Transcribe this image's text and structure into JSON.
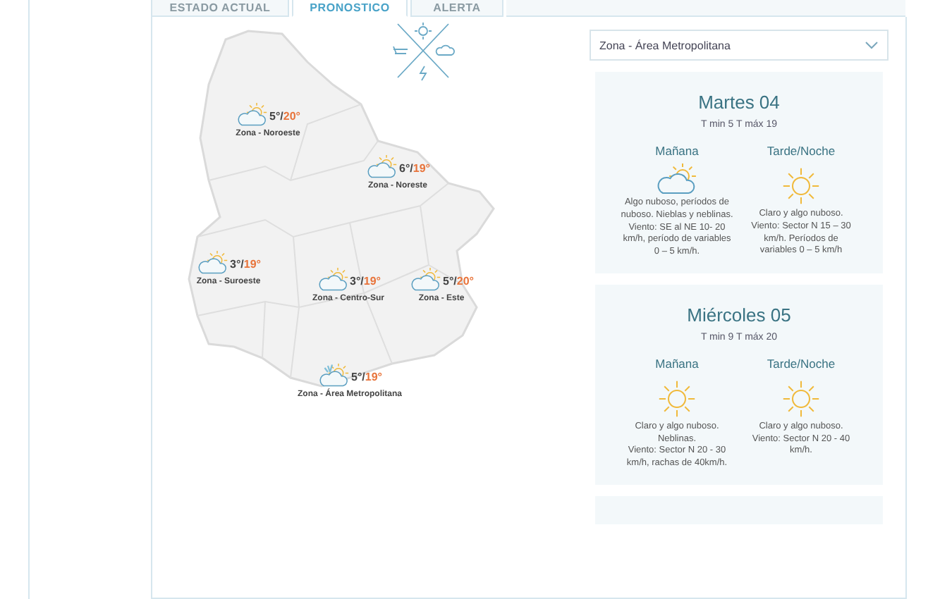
{
  "tabs": [
    {
      "label": "ESTADO ACTUAL",
      "selected": false
    },
    {
      "label": "PRONOSTICO",
      "selected": true
    },
    {
      "label": "ALERTA",
      "selected": false
    }
  ],
  "map": {
    "zones": [
      {
        "name": "Zona - Noroeste",
        "kind": "partly-cloudy",
        "min": "5°/",
        "max": "20°"
      },
      {
        "name": "Zona - Noreste",
        "kind": "partly-cloudy",
        "min": "6°/",
        "max": "19°"
      },
      {
        "name": "Zona - Suroeste",
        "kind": "partly-cloudy",
        "min": "3°/",
        "max": "19°"
      },
      {
        "name": "Zona - Centro-Sur",
        "kind": "partly-cloudy",
        "min": "3°/",
        "max": "19°"
      },
      {
        "name": "Zona - Este",
        "kind": "partly-cloudy",
        "min": "5°/",
        "max": "20°"
      },
      {
        "name": "Zona - Área Metropolitana",
        "kind": "mixed",
        "min": "5°/",
        "max": "19°"
      }
    ]
  },
  "zone_select": {
    "value": "Zona - Área Metropolitana"
  },
  "days": [
    {
      "title": "Martes 04",
      "temps": "T min 5 T máx 19",
      "periods": [
        {
          "label": "Mañana",
          "kind": "partly-cloudy",
          "text": "Algo nuboso, períodos de nuboso. Nieblas y neblinas.\nViento: SE al NE 10- 20 km/h, período de variables 0 – 5 km/h."
        },
        {
          "label": "Tarde/Noche",
          "kind": "sunny",
          "text": "Claro y algo nuboso.\nViento: Sector N 15 – 30 km/h. Períodos de variables 0 – 5 km/h"
        }
      ]
    },
    {
      "title": "Miércoles 05",
      "temps": "T min 9 T máx 20",
      "periods": [
        {
          "label": "Mañana",
          "kind": "sunny",
          "text": "Claro y algo nuboso. Neblinas.\nViento: Sector N 20 - 30 km/h, rachas de 40km/h."
        },
        {
          "label": "Tarde/Noche",
          "kind": "sunny",
          "text": "Claro y algo nuboso.\nViento: Sector N 20 - 40 km/h."
        }
      ]
    }
  ]
}
